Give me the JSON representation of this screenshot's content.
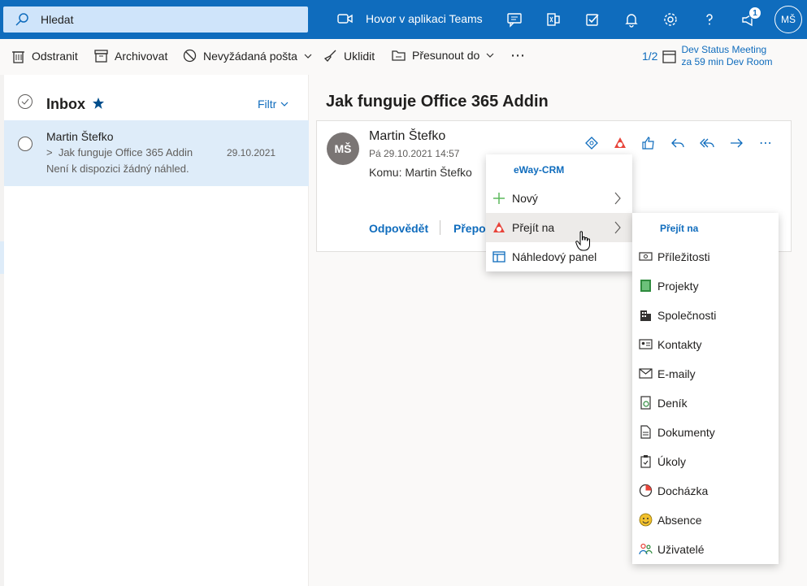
{
  "search": {
    "placeholder": "Hledat"
  },
  "header": {
    "teams_call": "Hovor v aplikaci Teams",
    "notification_count": "1",
    "user_initials": "MŠ"
  },
  "toolbar": {
    "delete": "Odstranit",
    "archive": "Archivovat",
    "junk": "Nevyžádaná pošta",
    "sweep": "Uklidit",
    "move": "Přesunout do",
    "more": "⋯",
    "meeting_count": "1/2",
    "meeting_title": "Dev Status Meeting",
    "meeting_time": "za 59 min Dev Room"
  },
  "list": {
    "folder": "Inbox",
    "filter": "Filtr",
    "items": [
      {
        "sender": "Martin Štefko",
        "subject": "Jak funguje Office 365 Addin",
        "date": "29.10.2021",
        "preview": "Není k dispozici žádný náhled."
      }
    ]
  },
  "message": {
    "subject": "Jak funguje Office 365 Addin",
    "avatar": "MŠ",
    "sender": "Martin Štefko",
    "date": "Pá 29.10.2021 14:57",
    "to": "Komu: Martin Štefko",
    "reply": "Odpovědět",
    "forward": "Přepos"
  },
  "eway_menu": {
    "header": "eWay-CRM",
    "items": [
      "Nový",
      "Přejít na",
      "Náhledový panel"
    ]
  },
  "goto_menu": {
    "header": "Přejít na",
    "items": [
      "Příležitosti",
      "Projekty",
      "Společnosti",
      "Kontakty",
      "E-maily",
      "Deník",
      "Dokumenty",
      "Úkoly",
      "Docházka",
      "Absence",
      "Uživatelé"
    ]
  },
  "colors": {
    "brand": "#0f6cbd",
    "selected": "#deecf9",
    "search_bg": "#cfe4fa"
  }
}
